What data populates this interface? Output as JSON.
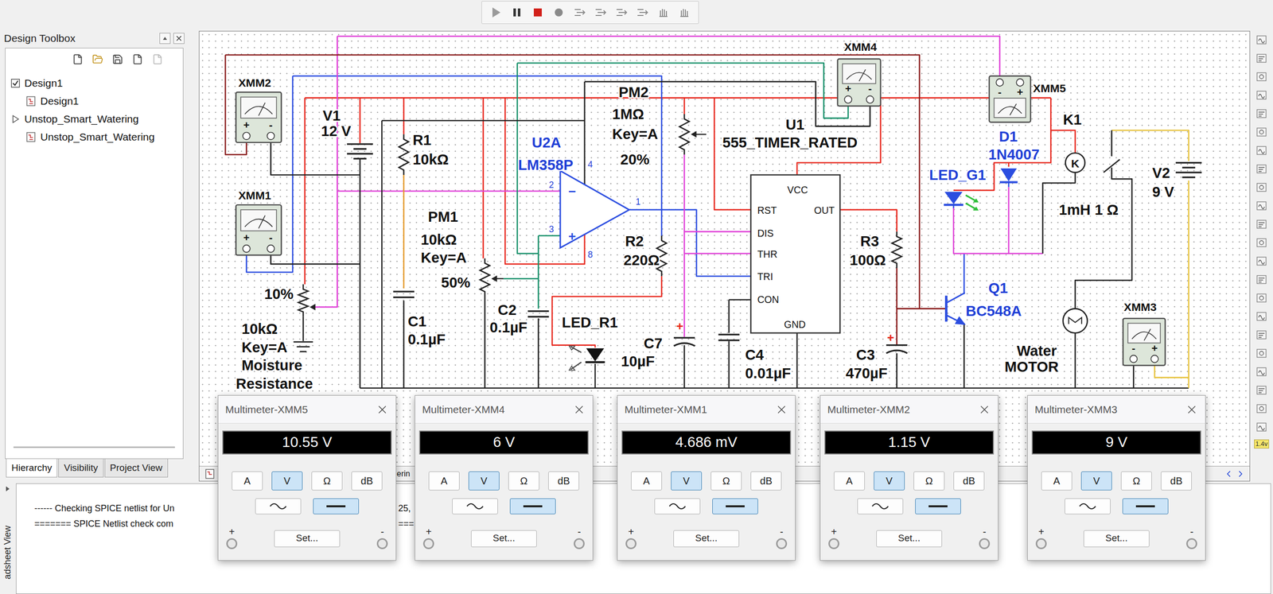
{
  "toolbar": {
    "badge": "1.4v"
  },
  "toolbox": {
    "title": "Design Toolbox",
    "tree": [
      {
        "label": "Design1",
        "depth": 0,
        "expanded": true
      },
      {
        "label": "Design1",
        "depth": 1,
        "expanded": false
      },
      {
        "label": "Unstop_Smart_Watering",
        "depth": 0,
        "expanded": false
      },
      {
        "label": "Unstop_Smart_Watering",
        "depth": 1,
        "expanded": false
      }
    ],
    "tabs": [
      {
        "label": "Hierarchy",
        "selected": true
      },
      {
        "label": "Visibility",
        "selected": false
      },
      {
        "label": "Project View",
        "selected": false
      }
    ]
  },
  "schematic": {
    "labels": [
      "XMM2",
      "XMM1",
      "V1",
      "12 V",
      "R1",
      "10kΩ",
      "U2A",
      "LM358P",
      "4",
      "2",
      "3",
      "1",
      "8",
      "PM2",
      "1MΩ",
      "Key=A",
      "20%",
      "U1",
      "555_TIMER_RATED",
      "XMM4",
      "XMM5",
      "D1",
      "1N4007",
      "K1",
      "LED_G1",
      "V2",
      "9 V",
      "1mH 1 Ω",
      "PM1",
      "10kΩ",
      "Key=A",
      "50%",
      "C1",
      "0.1µF",
      "C2",
      "0.1µF",
      "R2",
      "220Ω",
      "LED_R1",
      "C7",
      "10µF",
      "C4",
      "0.01µF",
      "R3",
      "100Ω",
      "C3",
      "470µF",
      "Q1",
      "BC548A",
      "Water",
      "MOTOR",
      "XMM3",
      "10%",
      "10kΩ",
      "Key=A",
      "Moisture",
      "Resistance"
    ],
    "pins_555": [
      "VCC",
      "RST",
      "OUT",
      "DIS",
      "THR",
      "TRI",
      "CON",
      "GND"
    ],
    "opamp_inputs": [
      "−",
      "+"
    ],
    "relay_coil": "K",
    "polarity_marks": [
      "+",
      "+"
    ],
    "meters": [
      {
        "terminals": [
          "+",
          "-"
        ]
      },
      {
        "terminals": [
          "+",
          "-"
        ]
      },
      {
        "terminals": [
          "+",
          "-"
        ]
      },
      {
        "terminals": [
          "-",
          "+"
        ]
      },
      {
        "terminals": [
          "-",
          "+"
        ]
      }
    ],
    "tab": "erin"
  },
  "console": {
    "side_label": "adsheet View",
    "lines": [
      "------ Checking SPICE netlist for Un",
      "======= SPICE Netlist check com"
    ],
    "fragments": [
      "25,",
      "==="
    ]
  },
  "multimeters": [
    {
      "title": "Multimeter-XMM5",
      "reading": "10.55 V",
      "units": [
        {
          "label": "A",
          "selected": false
        },
        {
          "label": "V",
          "selected": true
        },
        {
          "label": "Ω",
          "selected": false
        },
        {
          "label": "dB",
          "selected": false
        }
      ],
      "modes": [
        {
          "kind": "ac",
          "selected": false
        },
        {
          "kind": "dc",
          "selected": true
        }
      ],
      "set_button": "Set...",
      "terminals": [
        "+",
        "-"
      ]
    },
    {
      "title": "Multimeter-XMM4",
      "reading": "6 V",
      "units": [
        {
          "label": "A",
          "selected": false
        },
        {
          "label": "V",
          "selected": true
        },
        {
          "label": "Ω",
          "selected": false
        },
        {
          "label": "dB",
          "selected": false
        }
      ],
      "modes": [
        {
          "kind": "ac",
          "selected": false
        },
        {
          "kind": "dc",
          "selected": true
        }
      ],
      "set_button": "Set...",
      "terminals": [
        "+",
        "-"
      ]
    },
    {
      "title": "Multimeter-XMM1",
      "reading": "4.686 mV",
      "units": [
        {
          "label": "A",
          "selected": false
        },
        {
          "label": "V",
          "selected": true
        },
        {
          "label": "Ω",
          "selected": false
        },
        {
          "label": "dB",
          "selected": false
        }
      ],
      "modes": [
        {
          "kind": "ac",
          "selected": false
        },
        {
          "kind": "dc",
          "selected": true
        }
      ],
      "set_button": "Set...",
      "terminals": [
        "+",
        "-"
      ]
    },
    {
      "title": "Multimeter-XMM2",
      "reading": "1.15 V",
      "units": [
        {
          "label": "A",
          "selected": false
        },
        {
          "label": "V",
          "selected": true
        },
        {
          "label": "Ω",
          "selected": false
        },
        {
          "label": "dB",
          "selected": false
        }
      ],
      "modes": [
        {
          "kind": "ac",
          "selected": false
        },
        {
          "kind": "dc",
          "selected": true
        }
      ],
      "set_button": "Set...",
      "terminals": [
        "+",
        "-"
      ]
    },
    {
      "title": "Multimeter-XMM3",
      "reading": "9 V",
      "units": [
        {
          "label": "A",
          "selected": false
        },
        {
          "label": "V",
          "selected": true
        },
        {
          "label": "Ω",
          "selected": false
        },
        {
          "label": "dB",
          "selected": false
        }
      ],
      "modes": [
        {
          "kind": "ac",
          "selected": false
        },
        {
          "kind": "dc",
          "selected": true
        }
      ],
      "set_button": "Set...",
      "terminals": [
        "+",
        "-"
      ]
    }
  ]
}
